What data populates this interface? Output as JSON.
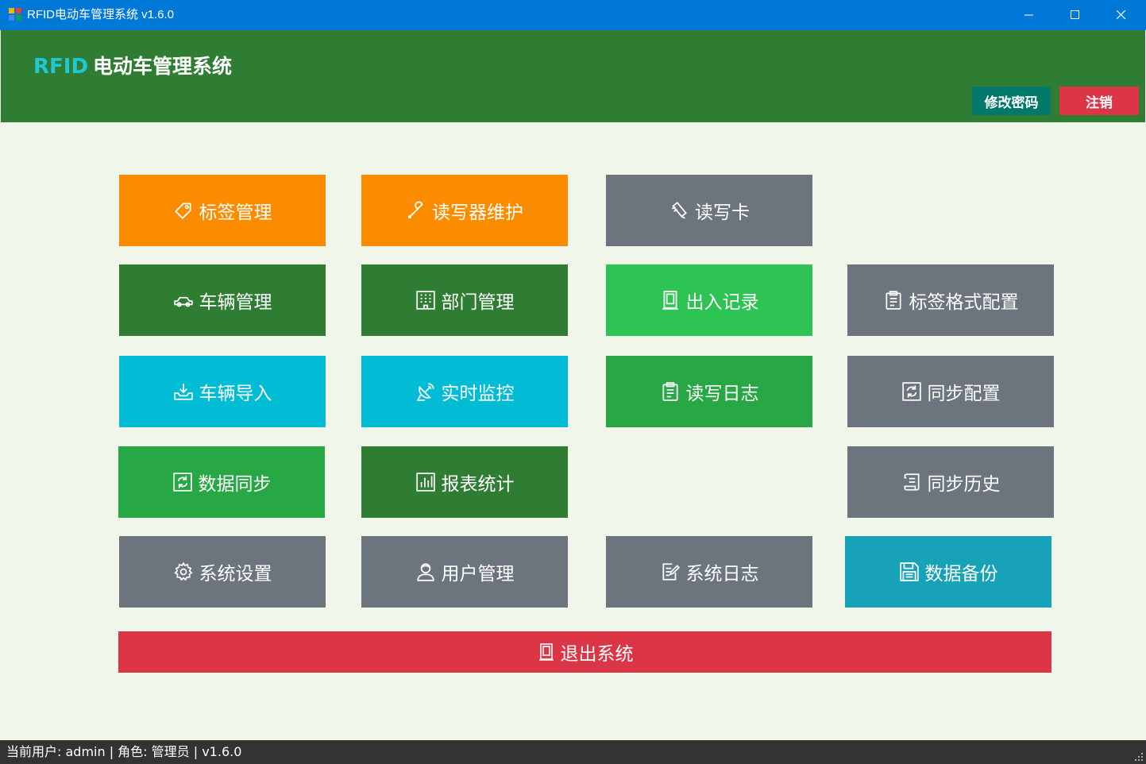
{
  "window": {
    "title": "RFID电动车管理系统 v1.6.0"
  },
  "header": {
    "brand_rfid": "RFID",
    "brand_name": "电动车管理系统",
    "change_password": "修改密码",
    "logout": "注销",
    "colors": {
      "change_password_bg": "#00796b",
      "logout_bg": "#dc3545"
    }
  },
  "tiles": {
    "tag_mgmt": "标签管理",
    "reader_maint": "读写器维护",
    "read_write_card": "读写卡",
    "vehicle_mgmt": "车辆管理",
    "dept_mgmt": "部门管理",
    "access_records": "出入记录",
    "tag_format": "标签格式配置",
    "vehicle_import": "车辆导入",
    "realtime_monitor": "实时监控",
    "rw_log": "读写日志",
    "sync_config": "同步配置",
    "data_sync": "数据同步",
    "reports": "报表统计",
    "sync_history": "同步历史",
    "sys_settings": "系统设置",
    "user_mgmt": "用户管理",
    "sys_log": "系统日志",
    "data_backup": "数据备份"
  },
  "exit_label": "退出系统",
  "status": {
    "text": "当前用户: admin | 角色: 管理员 | v1.6.0"
  },
  "icons": [
    "tag-icon",
    "wrench-icon",
    "pen-card-icon",
    "car-icon",
    "building-icon",
    "door-icon",
    "clipboard-icon",
    "upload-tray-icon",
    "satellite-dish-icon",
    "refresh-icon",
    "chart-icon",
    "scroll-icon",
    "gear-icon",
    "user-icon",
    "edit-document-icon",
    "floppy-disk-icon"
  ]
}
